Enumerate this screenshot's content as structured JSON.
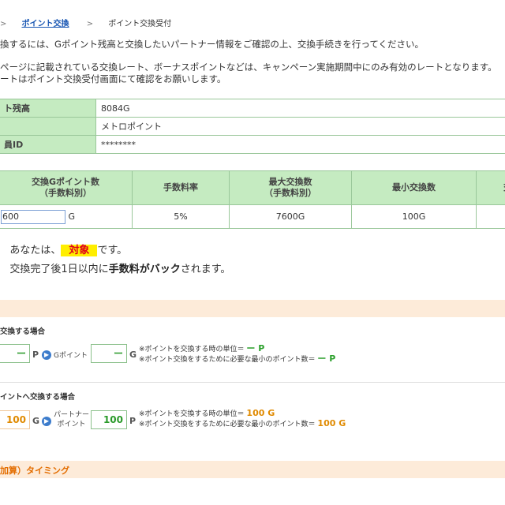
{
  "breadcrumb": {
    "sep1": ">",
    "link": "ポイント交換",
    "sep2": ">",
    "current": "ポイント交換受付"
  },
  "intro": "換するには、Gポイント残高と交換したいパートナー情報をご確認の上、交換手続きを行ってください。",
  "notice": {
    "line1": "ページに記載されている交換レート、ボーナスポイントなどは、キャンペーン実施期間中にのみ有効のレートとなります。",
    "line2": "ートはポイント交換受付画面にて確認をお願いします。"
  },
  "info": {
    "rows": [
      {
        "label": "ト残高",
        "value": "8084G"
      },
      {
        "label": "",
        "value": "メトロポイント"
      },
      {
        "label": "員ID",
        "value": "********"
      }
    ]
  },
  "exchange": {
    "headers": {
      "amount_1": "交換Gポイント数",
      "amount_2": "（手数料別）",
      "fee_rate": "手数料率",
      "max_1": "最大交換数",
      "max_2": "（手数料別）",
      "min": "最小交換数",
      "extra": "交"
    },
    "row": {
      "amount_value": "600",
      "amount_unit": "G",
      "fee_rate": "5%",
      "max": "7600G",
      "min": "100G",
      "extra": ""
    }
  },
  "target": {
    "prefix": "あなたは、",
    "highlight": "対象",
    "suffix": "です。"
  },
  "cashback": {
    "pre": "交換完了後1日以内に",
    "bold": "手数料がバック",
    "post": "されます。"
  },
  "section1": {
    "title": "交換する場合",
    "left_value": "ー",
    "left_unit": "P",
    "mid_label": "Gポイント",
    "right_value": "ー",
    "right_unit": "G",
    "note1_text": "※ポイントを交換する時の単位＝",
    "note1_value": "ー P",
    "note2_text": "※ポイント交換をするために必要な最小のポイント数＝",
    "note2_value": "ー P"
  },
  "section2": {
    "title": "イントへ交換する場合",
    "left_value": "100",
    "left_unit": "G",
    "mid_label_1": "パートナー",
    "mid_label_2": "ポイント",
    "right_value": "100",
    "right_unit": "P",
    "note1_text": "※ポイントを交換する時の単位＝",
    "note1_value": "100 G",
    "note2_text": "※ポイント交換をするために必要な最小のポイント数＝",
    "note2_value": "100 G"
  },
  "timing_title": "加算）タイミング",
  "colors": {
    "accent_green": "#c5ebc1",
    "orange": "#e36d00",
    "highlight": "#ffee00",
    "link": "#1a57b3"
  }
}
